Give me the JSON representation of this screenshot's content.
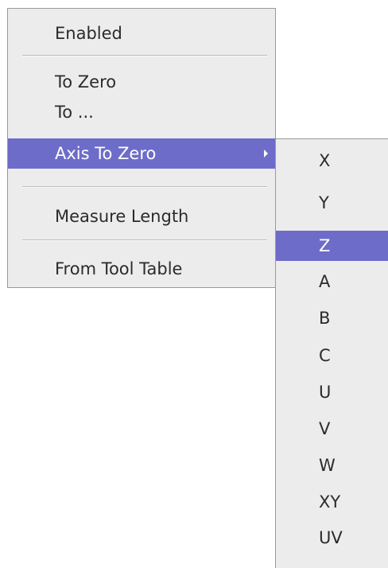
{
  "main_menu": {
    "items": [
      {
        "label": "Enabled"
      },
      {
        "label": "To Zero"
      },
      {
        "label": "To ..."
      },
      {
        "label": "Axis To Zero"
      },
      {
        "label": "Measure Length"
      },
      {
        "label": "From Tool Table"
      }
    ]
  },
  "axis_submenu": {
    "items": [
      {
        "label": "X"
      },
      {
        "label": "Y"
      },
      {
        "label": "Z"
      },
      {
        "label": "A"
      },
      {
        "label": "B"
      },
      {
        "label": "C"
      },
      {
        "label": "U"
      },
      {
        "label": "V"
      },
      {
        "label": "W"
      },
      {
        "label": "XY"
      },
      {
        "label": "UV"
      }
    ]
  },
  "colors": {
    "highlight": "#6e6cc9",
    "menu_background": "#ececec",
    "text": "#2b2b2b"
  }
}
